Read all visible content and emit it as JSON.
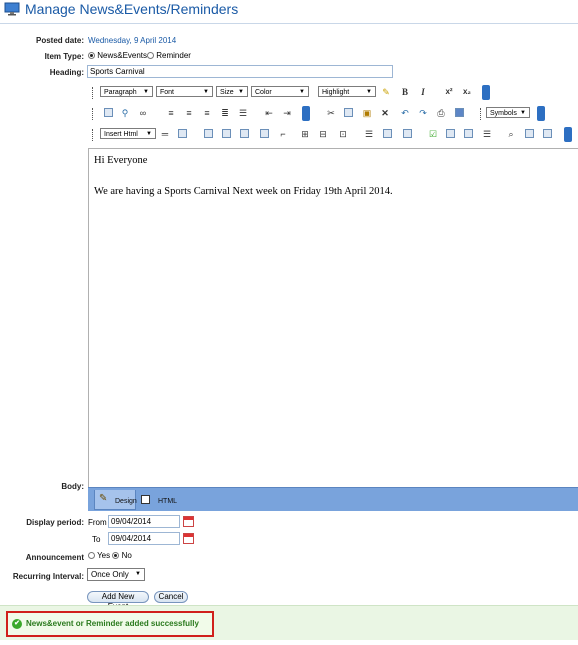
{
  "title": "Manage News&Events/Reminders",
  "form": {
    "posted_date_label": "Posted date:",
    "posted_date_value": "Wednesday, 9 April 2014",
    "item_type_label": "Item Type:",
    "item_type_options": [
      "News&Events",
      "Reminder"
    ],
    "item_type_selected": "News&Events",
    "heading_label": "Heading:",
    "heading_value": "Sports Carnival",
    "body_label": "Body:",
    "display_period_label": "Display period:",
    "from_label": "From",
    "from_value": "09/04/2014",
    "to_label": "To",
    "to_value": "09/04/2014",
    "announcement_label": "Announcement",
    "announcement_yes": "Yes",
    "announcement_no": "No",
    "announcement_selected": "No",
    "recurring_label": "Recurring Interval:",
    "recurring_value": "Once Only",
    "add_button": "Add New Event",
    "cancel_button": "Cancel"
  },
  "editor": {
    "dropdowns_row1": {
      "paragraph": "Paragraph",
      "font": "Font",
      "size": "Size",
      "color": "Color",
      "highlight": "Highlight"
    },
    "symbols": "Symbols",
    "insert_html": "Insert Html",
    "content": [
      "Hi Everyone",
      "We are having a Sports Carnival Next week on Friday 19th April 2014."
    ],
    "modes": {
      "design": "Design",
      "html": "HTML"
    },
    "bold": "B",
    "italic": "I",
    "superscript": "x²",
    "subscript": "x₂"
  },
  "message": "News&event or Reminder added successfully",
  "colors": {
    "accent": "#1a5aa6",
    "success": "#2a7a1d",
    "highlight_border": "#d0201b",
    "mode_bar": "#79a3dc"
  }
}
